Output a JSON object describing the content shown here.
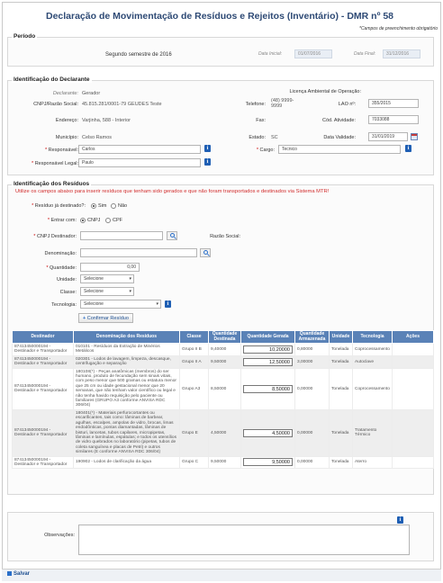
{
  "page": {
    "title": "Declaração de Movimentação de Resíduos e Rejeitos (Inventário) - DMR nº 58",
    "required_note": "*Campos de preenchimento obrigatório"
  },
  "periodo": {
    "legend": "Período",
    "text": "Segundo semestre de 2016",
    "data_inicial_label": "Data Inicial:",
    "data_inicial": "01/07/2016",
    "data_final_label": "Data Final:",
    "data_final": "31/12/2016"
  },
  "declarante": {
    "legend": "Identificação do Declarante",
    "declarante_label": "Declarante:",
    "declarante": "Gerador",
    "cnpj_label": "CNPJ/Razão Social:",
    "cnpj": "45.815.281/0001-79 GEUDES Teste",
    "licenca_label": "Licença Ambiental de Operação:",
    "telefone_label": "Telefone:",
    "telefone": "(48) 9999-9999",
    "lao_label": "LAO nº:",
    "lao": "355/2015",
    "endereco_label": "Endereço:",
    "endereco": "Varjinha, 588 - Interior",
    "fax_label": "Fax:",
    "cod_atividade_label": "Cód. Atividade:",
    "cod_atividade": "7033088",
    "municipio_label": "Município:",
    "municipio": "Celso Ramos",
    "estado_label": "Estado:",
    "estado": "SC",
    "data_validade_label": "Data Validade:",
    "data_validade": "31/01/2019",
    "responsavel_label": "Responsável:",
    "responsavel": "Carlos",
    "cargo_label": "Cargo:",
    "cargo": "Tecnico",
    "responsavel_legal_label": "Responsável Legal:",
    "responsavel_legal": "Paulo"
  },
  "residuos": {
    "legend": "Identificação dos Resíduos",
    "warning": "Utilize os campos abaixo para inserir resíduos que tenham sido gerados e que não foram transportados e destinados via Sistema MTR!",
    "destinado_label": "Resíduo já destinado?:",
    "sim": "Sim",
    "nao": "Não",
    "entrar_com_label": "Entrar com:",
    "cnpj_opt": "CNPJ",
    "cpf_opt": "CPF",
    "cnpj_destinador_label": "CNPJ Destinador:",
    "razao_social_label": "Razão Social:",
    "denominacao_label": "Denominação:",
    "quantidade_label": "Quantidade:",
    "quantidade_value": "0,00",
    "unidade_label": "Unidade:",
    "classe_label": "Classe:",
    "tecnologia_label": "Tecnologia:",
    "select_placeholder": "Selecione",
    "confirm_button": "Confirmar Resíduo",
    "table": {
      "headers": [
        "Destinador",
        "Denominação dos Resíduos",
        "Classe",
        "Quantidade Destinada",
        "Quantidade Gerada",
        "Quantidade Armazenada",
        "Unidade",
        "Tecnologia",
        "Ações"
      ],
      "rows": [
        {
          "destinador": "87413450000194 - Destinador e Transportador",
          "denominacao": "010101 - Resíduos da Extração de Minérios Metálicos",
          "classe": "Grupo II B",
          "destinada": "9,40000",
          "gerada": "10,20000",
          "armazenada": "0,80000",
          "unidade": "Tonelada",
          "tecnologia": "Coprocessamento"
        },
        {
          "destinador": "87413450000194 - Destinador e Transportador",
          "denominacao": "020301 - Lodos de lavagem, limpeza, descasque, centrifugação e separação",
          "classe": "Grupo II A",
          "destinada": "9,50000",
          "gerada": "12,50000",
          "armazenada": "3,00000",
          "unidade": "Tonelada",
          "tecnologia": "Autoclave"
        },
        {
          "destinador": "87413450000194 - Destinador e Transportador",
          "denominacao": "180108(*) - Peças anatômicas (membros) do ser humano, produto de fecundação sem sinais vitais, com peso menor que 500 gramas ou estatura menor que 25 cm ou idade gestacional menor que 20 semanas, que não tenham valor científico ou legal e não tenha havido requisição pelo paciente ou familiares (GRUPO A3 conforme ANVISA RDC 306/04)",
          "classe": "Grupo A3",
          "destinada": "8,50000",
          "gerada": "8,50000",
          "armazenada": "0,00000",
          "unidade": "Tonelada",
          "tecnologia": "Coprocessamento"
        },
        {
          "destinador": "87413450000194 - Destinador e Transportador",
          "denominacao": "180401(*) - Materiais perfurocortantes ou escarificantes, tais como: lâminas de barbear, agulhas, escalpes, ampolas de vidro, brocas, limas endodônticas, pontas diamantadas, lâminas de bisturi, lancetas, tubos capilares, micropipetas, lâminas e lamínulas, espátulas; e todos os utensílios de vidro quebrados no laboratório (pipetas, tubos de coleta sanguínea e placas de Petri) e outros similares (E conforme ANVISA RDC 306/04)",
          "classe": "Grupo E",
          "destinada": "4,50000",
          "gerada": "4,50000",
          "armazenada": "0,00000",
          "unidade": "Tonelada",
          "tecnologia": "Tratamento Térmico"
        },
        {
          "destinador": "87413450000194 - Destinador e Transportador",
          "denominacao": "190902 - Lodos de clarificação da água",
          "classe": "Grupo C",
          "destinada": "9,50000",
          "gerada": "9,50000",
          "armazenada": "0,00000",
          "unidade": "Tonelada",
          "tecnologia": "Aterro"
        }
      ]
    }
  },
  "observacoes": {
    "label": "Observações:",
    "value": ""
  },
  "footer": {
    "save_label": "Salvar"
  }
}
